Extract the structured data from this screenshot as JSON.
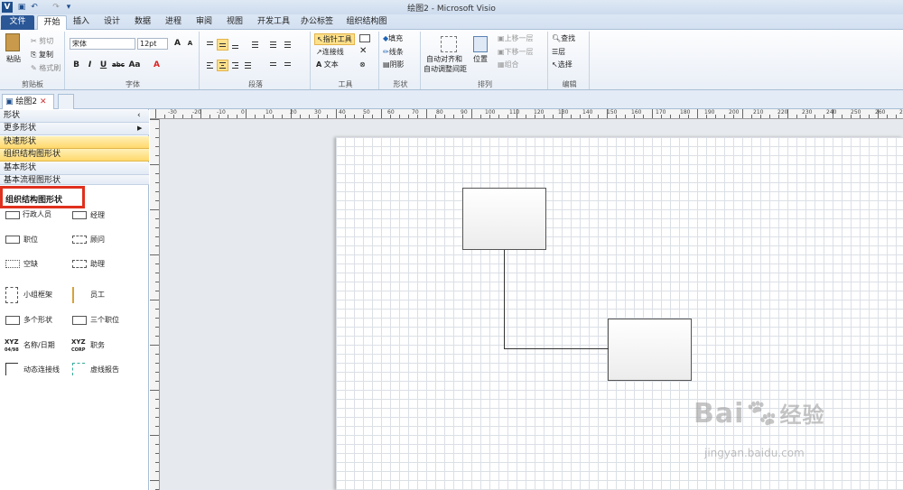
{
  "window": {
    "title": "绘图2 - Microsoft Visio"
  },
  "tabs": [
    "文件",
    "开始",
    "插入",
    "设计",
    "数据",
    "进程",
    "审阅",
    "视图",
    "开发工具",
    "办公标签",
    "组织结构图"
  ],
  "ribbon": {
    "clipboard": {
      "paste": "粘贴",
      "cut": "剪切",
      "copy": "复制",
      "format_painter": "格式刷",
      "label": "剪贴板"
    },
    "font": {
      "family": "宋体",
      "size": "12pt",
      "bold": "B",
      "italic": "I",
      "underline": "U",
      "strike": "abc",
      "case": "Aa",
      "color": "A",
      "grow": "A",
      "shrink": "A",
      "label": "字体"
    },
    "paragraph": {
      "label": "段落"
    },
    "tools": {
      "pointer": "指针工具",
      "connector": "连接线",
      "text": "文本",
      "label": "工具"
    },
    "shape": {
      "fill": "填充",
      "line": "线条",
      "shadow": "阴影",
      "label": "形状"
    },
    "arrange": {
      "auto_align": "自动对齐和",
      "auto_space": "自动调整间距",
      "position": "位置",
      "bring_forward": "上移一层",
      "send_backward": "下移一层",
      "group": "组合",
      "label": "排列"
    },
    "editing": {
      "find": "查找",
      "layers": "层",
      "select": "选择",
      "label": "编辑"
    }
  },
  "doc_tab": "绘图2",
  "shapes_panel": {
    "header": "形状",
    "more": "更多形状",
    "items": [
      "快速形状",
      "组织结构图形状",
      "基本形状",
      "基本流程图形状"
    ],
    "stencil_title": "组织结构图形状",
    "shapes": [
      "行政人员",
      "经理",
      "职位",
      "顾问",
      "空缺",
      "助理",
      "小组框架",
      "员工",
      "多个形状",
      "三个职位",
      "名称/日期",
      "职务",
      "动态连接线",
      "虚线报告"
    ]
  },
  "ruler": {
    "top_ticks": [
      "-30",
      "-20",
      "-10",
      "0",
      "10",
      "20",
      "30",
      "40",
      "50",
      "60",
      "70",
      "80",
      "90",
      "100",
      "110",
      "120",
      "130",
      "140",
      "150",
      "160",
      "170",
      "180",
      "190",
      "200",
      "210",
      "220",
      "230",
      "240",
      "250",
      "260",
      "270"
    ]
  },
  "watermark": {
    "main": "Bai",
    "mid": "经验",
    "sub": "jingyan.baidu.com"
  }
}
